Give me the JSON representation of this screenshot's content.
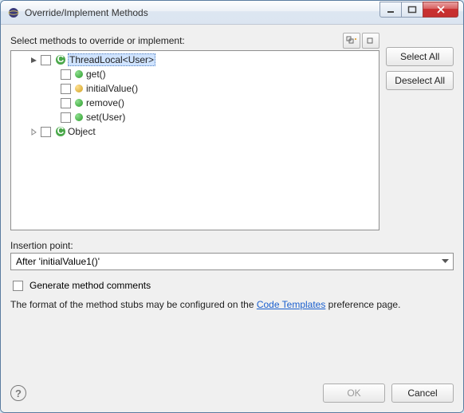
{
  "title": "Override/Implement Methods",
  "selectLabel": "Select methods to override or implement:",
  "tree": {
    "item0": {
      "label": "ThreadLocal<User>"
    },
    "m0": "get()",
    "m1": "initialValue()",
    "m2": "remove()",
    "m3": "set(User)",
    "item1": {
      "label": "Object"
    }
  },
  "buttons": {
    "selectAll": "Select All",
    "deselectAll": "Deselect All",
    "ok": "OK",
    "cancel": "Cancel"
  },
  "insertion": {
    "label": "Insertion point:",
    "value": "After 'initialValue1()'"
  },
  "genComments": "Generate method comments",
  "hintPrefix": "The format of the method stubs may be configured on the ",
  "hintLink": "Code Templates",
  "hintSuffix": " preference page."
}
